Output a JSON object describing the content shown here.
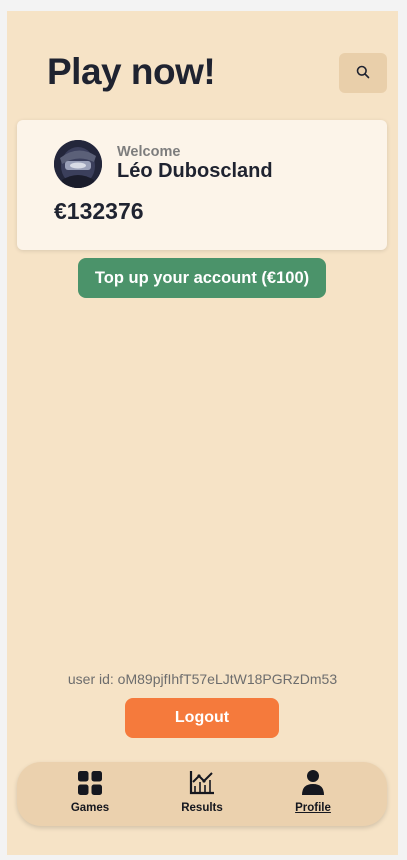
{
  "header": {
    "title": "Play now!"
  },
  "search": {
    "icon": "search-icon"
  },
  "profile_card": {
    "welcome": "Welcome",
    "name": "Léo Duboscland",
    "balance": "€132376"
  },
  "actions": {
    "topup_label": "Top up your account (€100)",
    "logout_label": "Logout"
  },
  "user": {
    "id_text": "user id: oM89pjfIhfT57eLJtW18PGRzDm53"
  },
  "nav": {
    "items": [
      {
        "label": "Games",
        "icon": "grid-icon",
        "active": false
      },
      {
        "label": "Results",
        "icon": "chart-icon",
        "active": false
      },
      {
        "label": "Profile",
        "icon": "user-icon",
        "active": true
      }
    ]
  },
  "colors": {
    "background": "#f6e3c6",
    "card": "#fcf4e9",
    "topup": "#4b936a",
    "logout": "#f57a3c",
    "nav": "#ebd1ae"
  }
}
